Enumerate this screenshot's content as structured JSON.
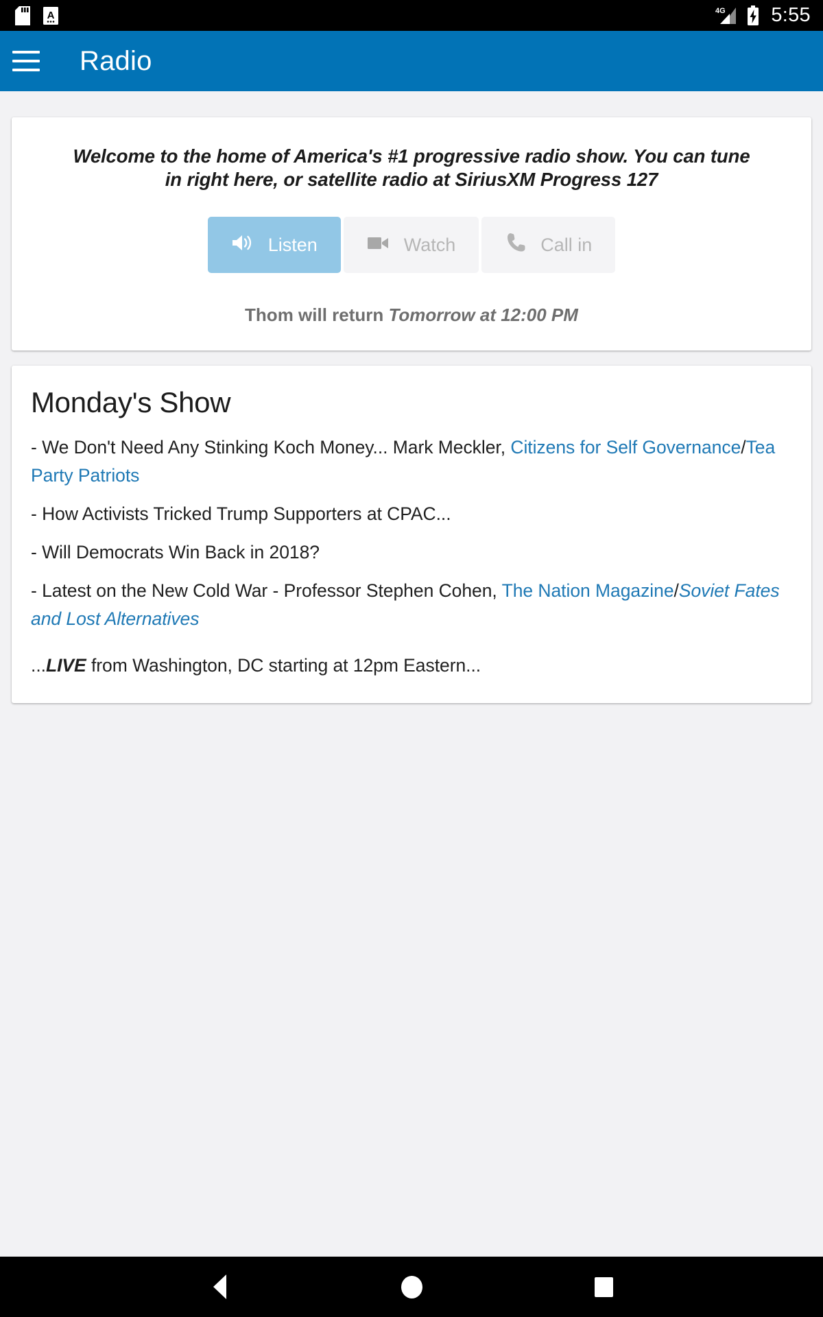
{
  "statusbar": {
    "icons": [
      "sd-card-icon",
      "note-a-icon",
      "signal-4g-icon",
      "battery-charging-icon"
    ],
    "network_label": "4G",
    "time": "5:55"
  },
  "appbar": {
    "menu_icon": "hamburger-menu-icon",
    "title": "Radio",
    "background_color": "#0273b6"
  },
  "welcome_card": {
    "message": "Welcome to the home of America's #1 progressive radio show. You can tune in right here, or satellite radio at SiriusXM Progress 127",
    "buttons": [
      {
        "label": "Listen",
        "icon": "volume-speaker-icon",
        "state": "active",
        "color": "#92c7e6"
      },
      {
        "label": "Watch",
        "icon": "video-camera-icon",
        "state": "disabled",
        "color": "#f4f4f6"
      },
      {
        "label": "Call in",
        "icon": "phone-icon",
        "state": "disabled",
        "color": "#f4f4f6"
      }
    ],
    "return_prefix": "Thom will return ",
    "return_when": "Tomorrow at 12:00 PM"
  },
  "show_card": {
    "title": "Monday's Show",
    "items": [
      {
        "parts": [
          {
            "text": "- We Don't Need Any Stinking Koch Money... Mark Meckler, ",
            "style": "plain"
          },
          {
            "text": "Citizens for Self Governance",
            "style": "link"
          },
          {
            "text": "/",
            "style": "plain"
          },
          {
            "text": "Tea Party Patriots",
            "style": "link"
          }
        ]
      },
      {
        "parts": [
          {
            "text": "- How Activists Tricked Trump Supporters at CPAC...",
            "style": "plain"
          }
        ]
      },
      {
        "parts": [
          {
            "text": "- Will Democrats Win Back in 2018?",
            "style": "plain"
          }
        ]
      },
      {
        "parts": [
          {
            "text": "- Latest on the New Cold War - Professor Stephen Cohen, ",
            "style": "plain"
          },
          {
            "text": "The Nation Magazine",
            "style": "link"
          },
          {
            "text": "/",
            "style": "plain"
          },
          {
            "text": "Soviet Fates and Lost Alternatives",
            "style": "link-italic"
          }
        ]
      }
    ],
    "live_note_prefix": "...",
    "live_note_emphasis": "LIVE",
    "live_note_rest": " from Washington, DC starting at 12pm Eastern...",
    "link_color": "#1f79b5"
  },
  "navbar": {
    "back": "back-triangle-icon",
    "home": "home-circle-icon",
    "recents": "recents-square-icon"
  }
}
